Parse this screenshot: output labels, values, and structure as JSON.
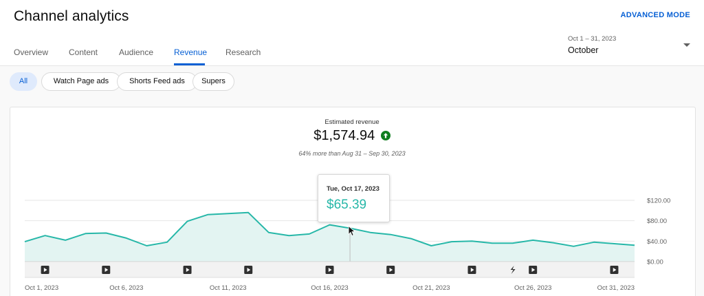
{
  "header": {
    "title": "Channel analytics",
    "advanced_mode": "ADVANCED MODE",
    "tabs": [
      {
        "label": "Overview",
        "active": false
      },
      {
        "label": "Content",
        "active": false
      },
      {
        "label": "Audience",
        "active": false
      },
      {
        "label": "Revenue",
        "active": true
      },
      {
        "label": "Research",
        "active": false
      }
    ],
    "date_picker": {
      "range": "Oct 1 – 31, 2023",
      "label": "October"
    }
  },
  "filters": {
    "chips": [
      {
        "label": "All",
        "selected": true
      },
      {
        "label": "Watch Page ads",
        "selected": false
      },
      {
        "label": "Shorts Feed ads",
        "selected": false
      },
      {
        "label": "Supers",
        "selected": false
      }
    ]
  },
  "metric": {
    "label": "Estimated revenue",
    "value": "$1,574.94",
    "trend_icon": "arrow-up-icon",
    "comparison": "64% more than Aug 31 – Sep 30, 2023"
  },
  "tooltip": {
    "date": "Tue, Oct 17, 2023",
    "value": "$65.39"
  },
  "colors": {
    "accent_blue": "#065fd4",
    "series_teal": "#26b7a8",
    "area_fill": "#e3f4f2",
    "trend_green": "#0f7d1f"
  },
  "chart_data": {
    "type": "area",
    "x": [
      "Oct 1",
      "Oct 2",
      "Oct 3",
      "Oct 4",
      "Oct 5",
      "Oct 6",
      "Oct 7",
      "Oct 8",
      "Oct 9",
      "Oct 10",
      "Oct 11",
      "Oct 12",
      "Oct 13",
      "Oct 14",
      "Oct 15",
      "Oct 16",
      "Oct 17",
      "Oct 18",
      "Oct 19",
      "Oct 20",
      "Oct 21",
      "Oct 22",
      "Oct 23",
      "Oct 24",
      "Oct 25",
      "Oct 26",
      "Oct 27",
      "Oct 28",
      "Oct 29",
      "Oct 30",
      "Oct 31"
    ],
    "series": [
      {
        "values": [
          39,
          51,
          42,
          55,
          56,
          46,
          31,
          38,
          79,
          92,
          94,
          96,
          57,
          51,
          54,
          72,
          65.39,
          57,
          53,
          45,
          31,
          39,
          40,
          36,
          36,
          42,
          37,
          30,
          38,
          35,
          32
        ]
      }
    ],
    "xticks": [
      "Oct 1, 2023",
      "Oct 6, 2023",
      "Oct 11, 2023",
      "Oct 16, 2023",
      "Oct 21, 2023",
      "Oct 26, 2023",
      "Oct 31, 2023"
    ],
    "xtick_days": [
      1,
      6,
      11,
      16,
      21,
      26,
      31
    ],
    "yticks": [
      "$120.00",
      "$80.00",
      "$40.00",
      "$0.00"
    ],
    "ytick_values": [
      120,
      80,
      40,
      0
    ],
    "ylim": [
      0,
      120
    ],
    "grid": true,
    "highlight_day": 17,
    "video_markers": [
      {
        "day": 2,
        "icon": "play-icon"
      },
      {
        "day": 5,
        "icon": "play-icon"
      },
      {
        "day": 9,
        "icon": "play-icon"
      },
      {
        "day": 12,
        "icon": "play-icon"
      },
      {
        "day": 16,
        "icon": "play-icon"
      },
      {
        "day": 19,
        "icon": "play-icon"
      },
      {
        "day": 23,
        "icon": "play-icon"
      },
      {
        "day": 25,
        "icon": "shorts-icon"
      },
      {
        "day": 26,
        "icon": "play-icon"
      },
      {
        "day": 30,
        "icon": "play-icon"
      }
    ]
  }
}
